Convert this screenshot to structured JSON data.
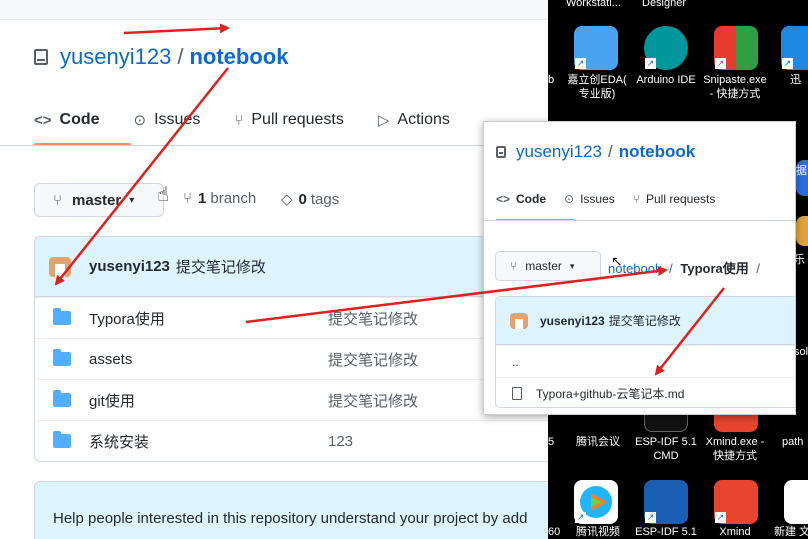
{
  "github": {
    "owner": "yusenyi123",
    "separator": "/",
    "repo": "notebook",
    "tabs": [
      {
        "icon": "<>",
        "label": "Code"
      },
      {
        "icon": "⊙",
        "label": "Issues"
      },
      {
        "icon": "⑂",
        "label": "Pull requests"
      },
      {
        "icon": "▷",
        "label": "Actions"
      }
    ],
    "branch_button": {
      "icon": "⑂",
      "label": "master",
      "caret": "▾"
    },
    "branch_count": {
      "num": "1",
      "label": "branch"
    },
    "tag_count": {
      "num": "0",
      "label": "tags"
    },
    "commit": {
      "author": "yusenyi123",
      "message": "提交笔记修改"
    },
    "files": [
      {
        "name": "Typora使用",
        "message": "提交笔记修改"
      },
      {
        "name": "assets",
        "message": "提交笔记修改"
      },
      {
        "name": "git使用",
        "message": "提交笔记修改"
      },
      {
        "name": "系统安装",
        "message": "123"
      }
    ],
    "about_text": "Help people interested in this repository understand your project by add"
  },
  "popup": {
    "owner": "yusenyi123",
    "separator": "/",
    "repo": "notebook",
    "tabs": [
      {
        "icon": "<>",
        "label": "Code"
      },
      {
        "icon": "⊙",
        "label": "Issues"
      },
      {
        "icon": "⑂",
        "label": "Pull requests"
      }
    ],
    "branch_button": {
      "icon": "⑂",
      "label": "master",
      "caret": "▾"
    },
    "breadcrumb": {
      "root": "notebook",
      "sep1": "/",
      "folder": "Typora使用",
      "sep2": "/"
    },
    "commit": {
      "author": "yusenyi123",
      "message": "提交笔记修改"
    },
    "parent_dir": "..",
    "file": "Typora+github-云笔记本.md"
  },
  "desktop": {
    "top_labels": [
      "Workstati...",
      "Designer"
    ],
    "row1": [
      {
        "label": "嘉立创EDA(\n专业版)",
        "color": "#4aa3f0"
      },
      {
        "label": "Arduino IDE",
        "color": "#00979c"
      },
      {
        "label": "Snipaste.exe\n- 快捷方式",
        "color": "#e63b2e"
      },
      {
        "label": "迅",
        "color": "#1e88e5"
      }
    ],
    "edge_fragments": [
      "b",
      "据",
      "乐",
      "sol",
      "5",
      "0"
    ],
    "row2": [
      {
        "label": "腾讯会议"
      },
      {
        "label": "ESP-IDF 5.1\nCMD"
      },
      {
        "label": "Xmind.exe -\n快捷方式"
      },
      {
        "label": "path"
      }
    ],
    "row3": [
      {
        "label": "腾讯视频",
        "color": "#ffffff"
      },
      {
        "label": "ESP-IDF 5.1",
        "color": "#1a5fb4"
      },
      {
        "label": "Xmind",
        "color": "#e8442e"
      },
      {
        "label": "新建 文",
        "color": "#ffffff"
      }
    ],
    "row3_left_fragment": "60"
  },
  "annotation_color": "#e02020"
}
